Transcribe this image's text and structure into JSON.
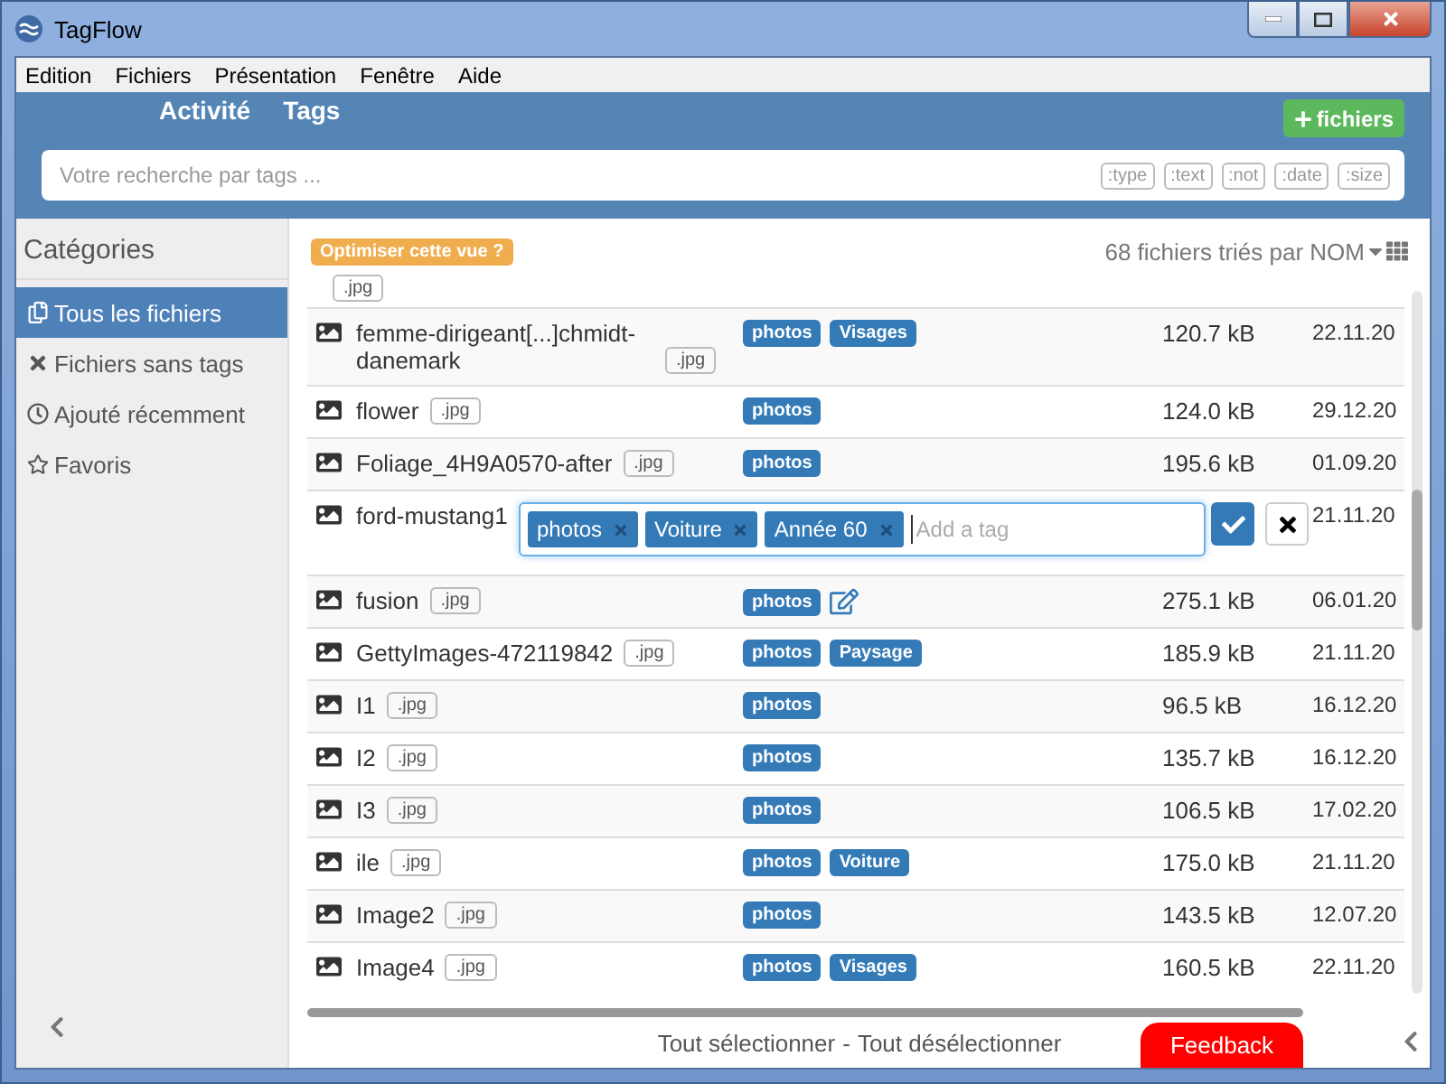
{
  "window": {
    "title": "TagFlow"
  },
  "menu": [
    "Edition",
    "Fichiers",
    "Présentation",
    "Fenêtre",
    "Aide"
  ],
  "nav_tabs": [
    "Activité",
    "Tags"
  ],
  "add_button": "fichiers",
  "search": {
    "placeholder": "Votre recherche par tags ...",
    "filters": [
      ":type",
      ":text",
      ":not",
      ":date",
      ":size"
    ]
  },
  "sidebar": {
    "title": "Catégories",
    "items": [
      {
        "label": "Tous les fichiers",
        "kind": "all",
        "selected": true
      },
      {
        "label": "Fichiers sans tags",
        "kind": "untagged",
        "selected": false
      },
      {
        "label": "Ajouté récemment",
        "kind": "recent",
        "selected": false
      },
      {
        "label": "Favoris",
        "kind": "favorites",
        "selected": false
      }
    ]
  },
  "toolbar": {
    "optimize_button": "Optimiser cette vue ?",
    "sort_label": "68 fichiers triés par NOM"
  },
  "files": [
    {
      "kind": "stub",
      "extension": ".jpg"
    },
    {
      "kind": "file",
      "name": "femme-dirigeant[...]chmidt-danemark",
      "extension": ".jpg",
      "tags": [
        "photos",
        "Visages"
      ],
      "size": "120.7 kB",
      "date": "22.11.20",
      "show_edit": false
    },
    {
      "kind": "file",
      "name": "flower",
      "extension": ".jpg",
      "tags": [
        "photos"
      ],
      "size": "124.0 kB",
      "date": "29.12.20",
      "show_edit": false
    },
    {
      "kind": "file",
      "name": "Foliage_4H9A0570-after",
      "extension": ".jpg",
      "tags": [
        "photos"
      ],
      "size": "195.6 kB",
      "date": "01.09.20",
      "show_edit": false
    },
    {
      "kind": "file",
      "name": "ford-mustang1",
      "date": "21.11.20",
      "show_edit": false,
      "editor": {
        "tags": [
          "photos",
          "Voiture",
          "Année 60"
        ],
        "placeholder": "Add a tag"
      }
    },
    {
      "kind": "file",
      "name": "fusion",
      "extension": ".jpg",
      "tags": [
        "photos"
      ],
      "size": "275.1 kB",
      "date": "06.01.20",
      "show_edit": true
    },
    {
      "kind": "file",
      "name": "GettyImages-472119842",
      "extension": ".jpg",
      "tags": [
        "photos",
        "Paysage"
      ],
      "size": "185.9 kB",
      "date": "21.11.20",
      "show_edit": false
    },
    {
      "kind": "file",
      "name": "I1",
      "extension": ".jpg",
      "tags": [
        "photos"
      ],
      "size": "96.5 kB",
      "date": "16.12.20",
      "show_edit": false
    },
    {
      "kind": "file",
      "name": "I2",
      "extension": ".jpg",
      "tags": [
        "photos"
      ],
      "size": "135.7 kB",
      "date": "16.12.20",
      "show_edit": false
    },
    {
      "kind": "file",
      "name": "I3",
      "extension": ".jpg",
      "tags": [
        "photos"
      ],
      "size": "106.5 kB",
      "date": "17.02.20",
      "show_edit": false
    },
    {
      "kind": "file",
      "name": "ile",
      "extension": ".jpg",
      "tags": [
        "photos",
        "Voiture"
      ],
      "size": "175.0 kB",
      "date": "21.11.20",
      "show_edit": false
    },
    {
      "kind": "file",
      "name": "Image2",
      "extension": ".jpg",
      "tags": [
        "photos"
      ],
      "size": "143.5 kB",
      "date": "12.07.20",
      "show_edit": false
    },
    {
      "kind": "file",
      "name": "Image4",
      "extension": ".jpg",
      "tags": [
        "photos",
        "Visages"
      ],
      "size": "160.5 kB",
      "date": "22.11.20",
      "show_edit": false
    }
  ],
  "footer": {
    "select_all": "Tout sélectionner",
    "separator": "-",
    "deselect_all": "Tout désélectionner",
    "feedback": "Feedback"
  }
}
